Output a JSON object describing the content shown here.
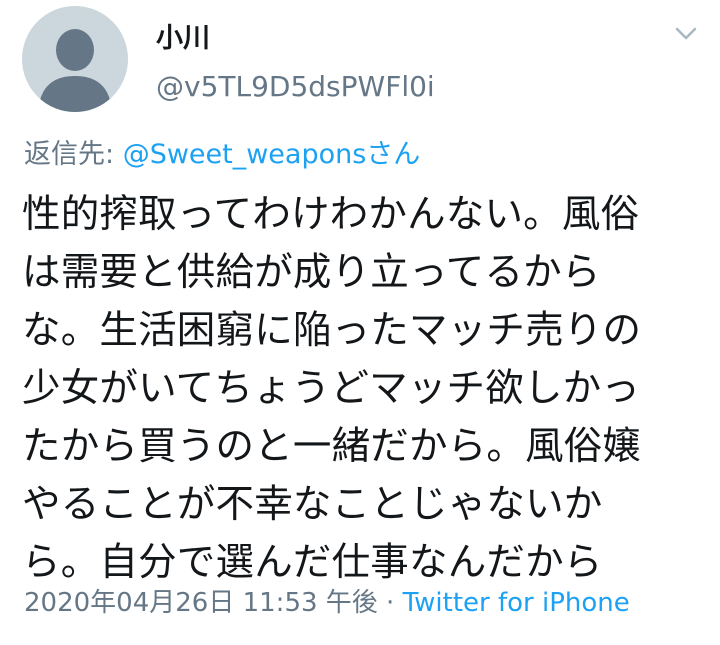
{
  "user": {
    "display_name": "小川",
    "handle": "@v5TL9D5dsPWFl0i",
    "avatar_icon": "default-avatar-icon"
  },
  "header": {
    "menu_icon": "chevron-down-icon"
  },
  "reply": {
    "prefix": "返信先: ",
    "mention": "@Sweet_weaponsさん"
  },
  "tweet": {
    "text": "性的搾取ってわけわかんない。風俗\nは需要と供給が成り立ってるから\nな。生活困窮に陥ったマッチ売りの\n少女がいてちょうどマッチ欲しかっ\nたから買うのと一緒だから。風俗嬢\nやることが不幸なことじゃないか\nら。自分で選んだ仕事なんだから"
  },
  "meta": {
    "timestamp": "2020年04月26日 11:53 午後",
    "separator": " · ",
    "source": "Twitter for iPhone"
  },
  "colors": {
    "accent": "#1da1f2",
    "secondary_text": "#657786",
    "primary_text": "#14171a",
    "avatar_bg": "#ccd6dd",
    "avatar_fg": "#657786"
  }
}
